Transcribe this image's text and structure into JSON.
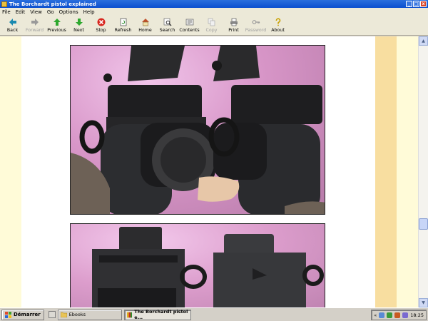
{
  "window": {
    "title": "The Borchardt pistol explained"
  },
  "menu": [
    "File",
    "Edit",
    "View",
    "Go",
    "Options",
    "Help"
  ],
  "toolbar": [
    {
      "label": "Back",
      "icon": "back-arrow-icon",
      "enabled": true
    },
    {
      "label": "Forward",
      "icon": "forward-arrow-icon",
      "enabled": false
    },
    {
      "label": "Previous",
      "icon": "up-arrow-icon",
      "enabled": true
    },
    {
      "label": "Next",
      "icon": "down-arrow-icon",
      "enabled": true
    },
    {
      "label": "Stop",
      "icon": "stop-icon",
      "enabled": true
    },
    {
      "label": "Refresh",
      "icon": "refresh-icon",
      "enabled": true
    },
    {
      "label": "Home",
      "icon": "home-icon",
      "enabled": true
    },
    {
      "label": "Search",
      "icon": "search-icon",
      "enabled": true
    },
    {
      "label": "Contents",
      "icon": "contents-icon",
      "enabled": true
    },
    {
      "label": "Copy",
      "icon": "copy-icon",
      "enabled": false
    },
    {
      "label": "Print",
      "icon": "print-icon",
      "enabled": true
    },
    {
      "label": "Password",
      "icon": "key-icon",
      "enabled": false
    },
    {
      "label": "About",
      "icon": "about-icon",
      "enabled": true
    }
  ],
  "taskbar": {
    "start_label": "Démarrer",
    "tasks": [
      {
        "label": "Ebooks",
        "icon": "folder-icon",
        "active": false
      },
      {
        "label": "The Borchardt pistol e...",
        "icon": "ebook-icon",
        "active": true
      }
    ],
    "clock": "18:25"
  },
  "colors": {
    "titlebar": "#0b4fcf",
    "page_background": "#fffbd8",
    "stripe": "#f8dea0",
    "photo_background": "#d896c8"
  }
}
